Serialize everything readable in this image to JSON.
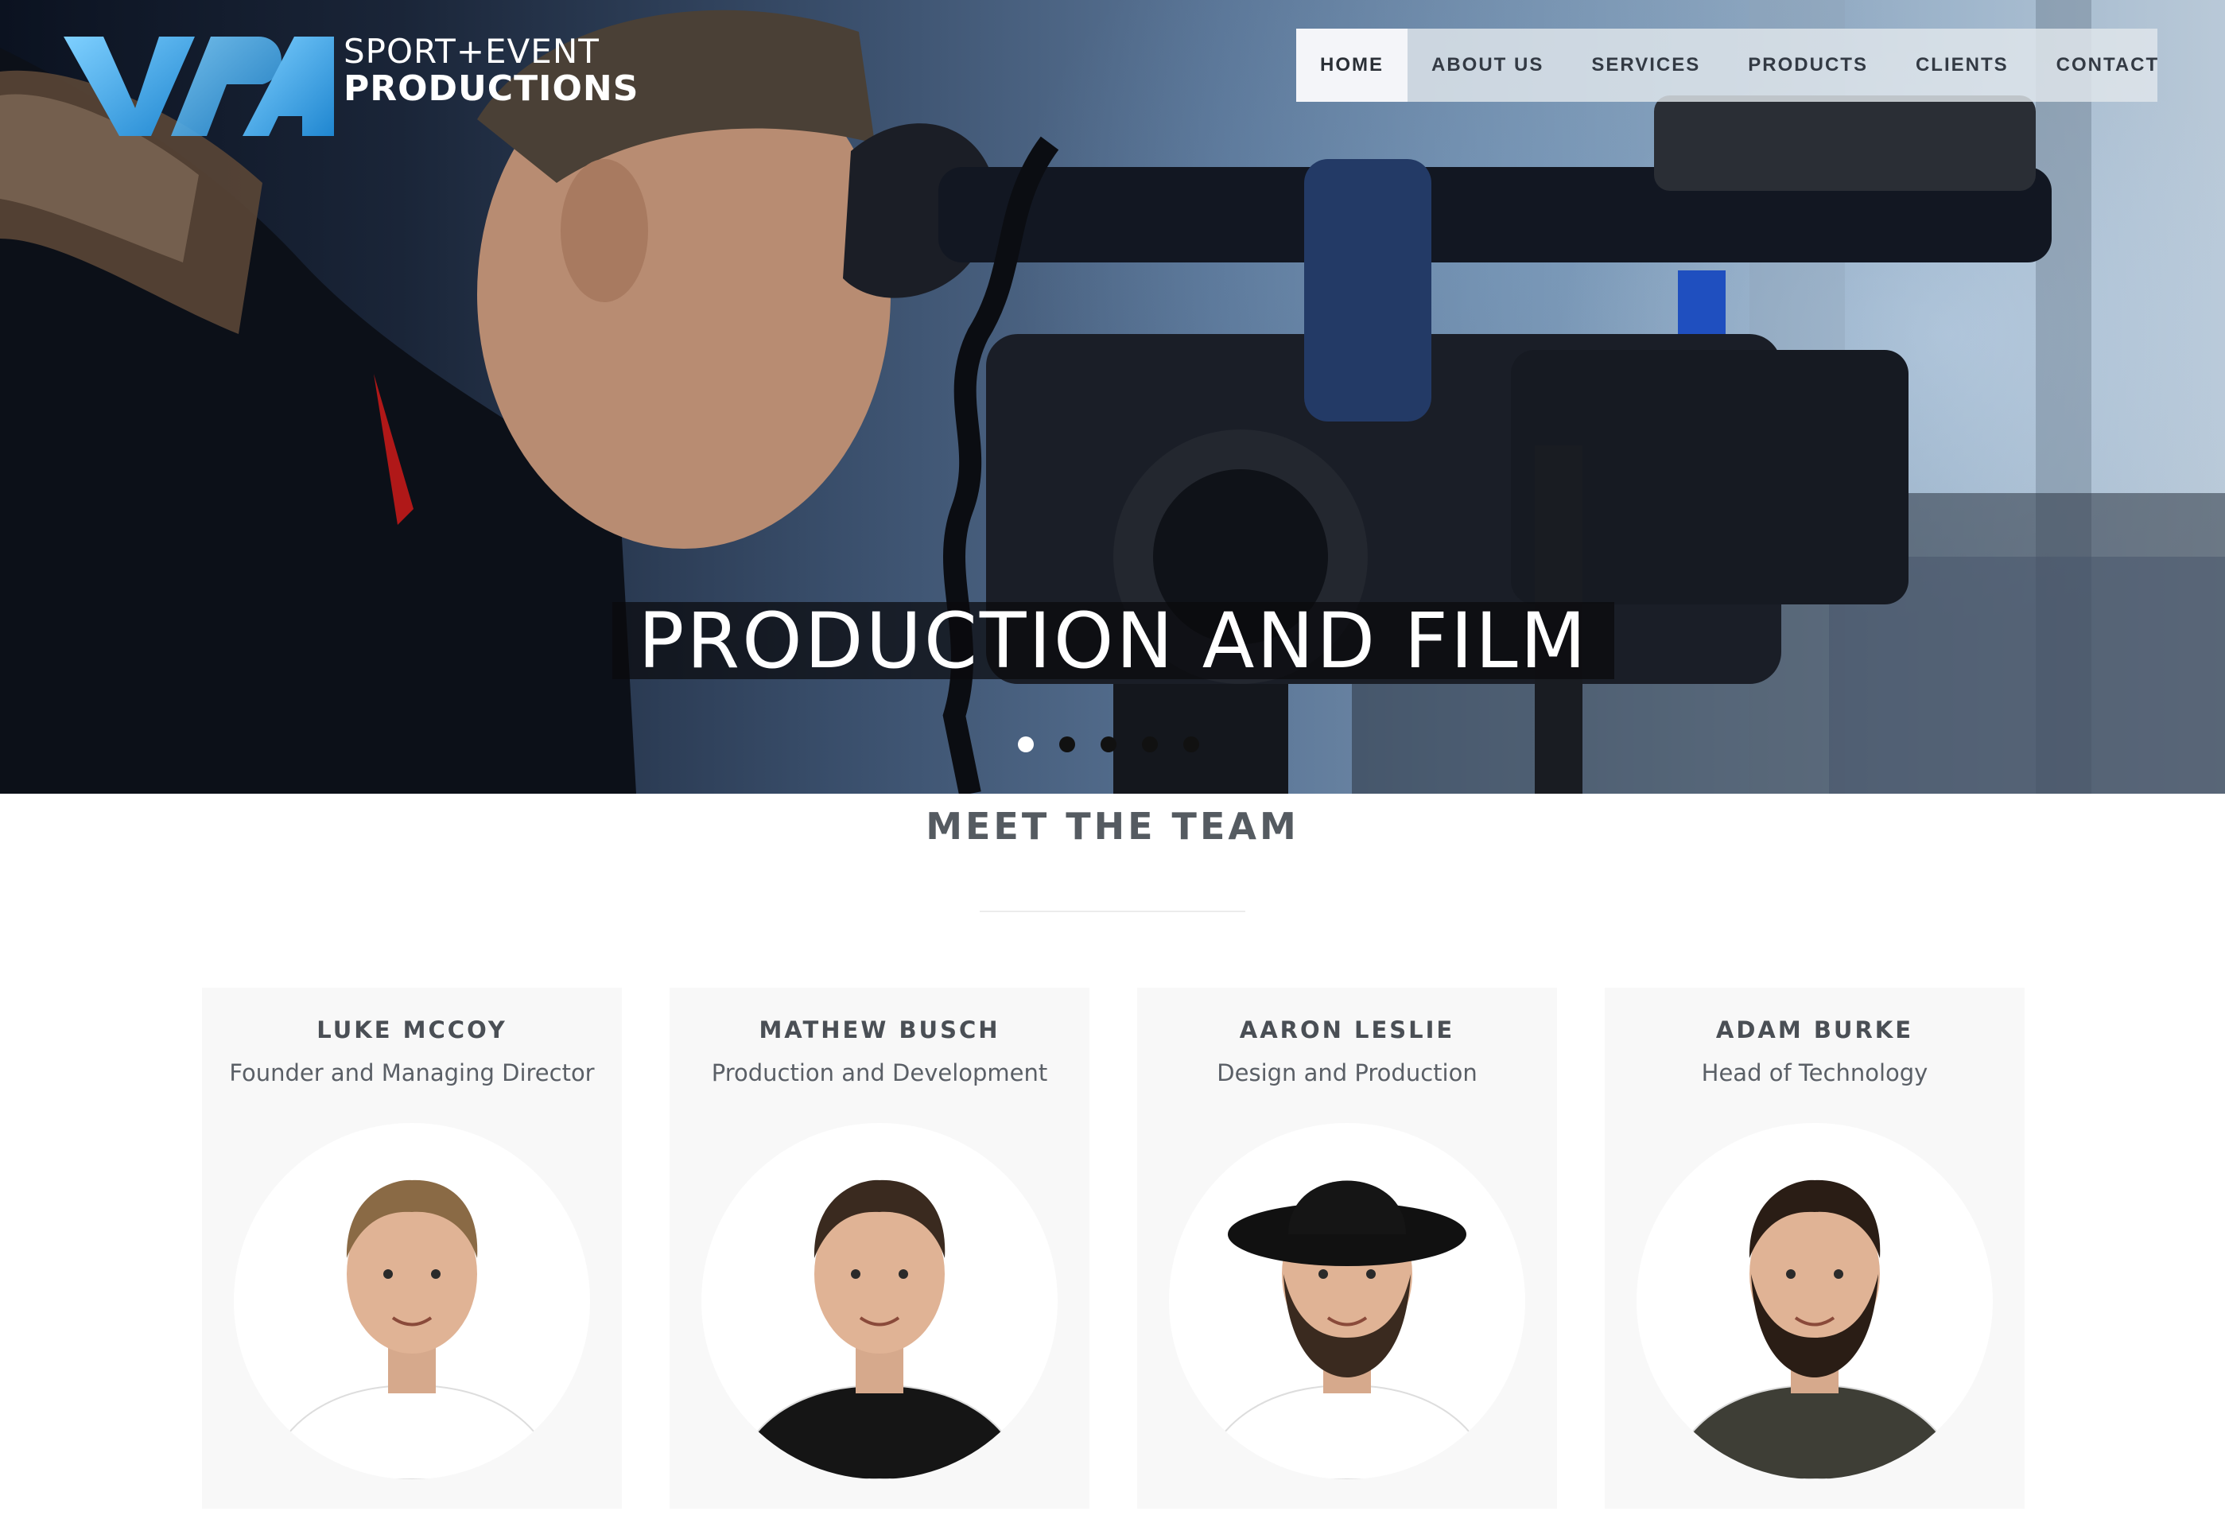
{
  "brand": {
    "line1": "SPORT+EVENT",
    "line2": "PRODUCTIONS",
    "logo_mark": "VPA",
    "accent": "#2f9fe0"
  },
  "nav": {
    "items": [
      {
        "label": "HOME",
        "active": true
      },
      {
        "label": "ABOUT US",
        "active": false
      },
      {
        "label": "SERVICES",
        "active": false
      },
      {
        "label": "PRODUCTS",
        "active": false
      },
      {
        "label": "CLIENTS",
        "active": false
      },
      {
        "label": "CONTACT",
        "active": false
      }
    ]
  },
  "hero": {
    "caption": "PRODUCTION AND FILM",
    "slide_count": 5,
    "active_slide": 1
  },
  "team": {
    "title": "MEET THE TEAM",
    "members": [
      {
        "name": "LUKE MCCOY",
        "role": "Founder and Managing Director",
        "shirt": "#ffffff",
        "hair": "#8a6a45",
        "hat": false,
        "beard": false
      },
      {
        "name": "MATHEW BUSCH",
        "role": "Production and Development",
        "shirt": "#151515",
        "hair": "#3a2a1f",
        "hat": false,
        "beard": false
      },
      {
        "name": "AARON LESLIE",
        "role": "Design and Production",
        "shirt": "#ffffff",
        "hair": "#3a2a1f",
        "hat": true,
        "beard": true
      },
      {
        "name": "ADAM BURKE",
        "role": "Head of Technology",
        "shirt": "#3e3e36",
        "hair": "#2a1d15",
        "hat": false,
        "beard": true
      }
    ]
  }
}
